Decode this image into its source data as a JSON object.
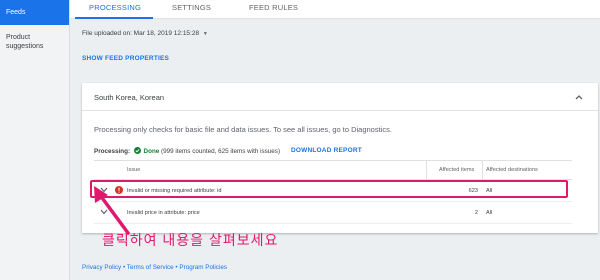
{
  "sidebar": {
    "items": [
      {
        "label": "Feeds"
      },
      {
        "label": "Product suggestions"
      }
    ]
  },
  "tabs": [
    {
      "label": "PROCESSING"
    },
    {
      "label": "SETTINGS"
    },
    {
      "label": "FEED RULES"
    }
  ],
  "file": {
    "uploaded_label": "File uploaded on: Mar 18, 2019 12:15:28"
  },
  "show_feed_properties": "SHOW FEED PROPERTIES",
  "card": {
    "region": "South Korea, Korean",
    "info": "Processing only checks for basic file and data issues. To see all issues, go to Diagnostics.",
    "processing_label": "Processing:",
    "status": "Done",
    "status_detail": "(999 items counted, 625 items with issues)",
    "download": "DOWNLOAD REPORT"
  },
  "table": {
    "headers": {
      "issue": "Issue",
      "affected": "Affected items",
      "destinations": "Affected destinations"
    },
    "rows": [
      {
        "issue": "Invalid or missing required attribute: id",
        "affected": "623",
        "destinations": "All"
      },
      {
        "issue": "Invalid price in attribute: price",
        "affected": "2",
        "destinations": "All"
      }
    ]
  },
  "annotation": "클릭하여 내용을 살펴보세요",
  "footer": {
    "privacy": "Privacy Policy",
    "sep1": " • ",
    "terms": "Terms of Service",
    "sep2": " • ",
    "program": "Program Policies"
  },
  "colors": {
    "accent": "#1a73e8",
    "annotation": "#e0196e",
    "success": "#188038",
    "error": "#d93025"
  }
}
